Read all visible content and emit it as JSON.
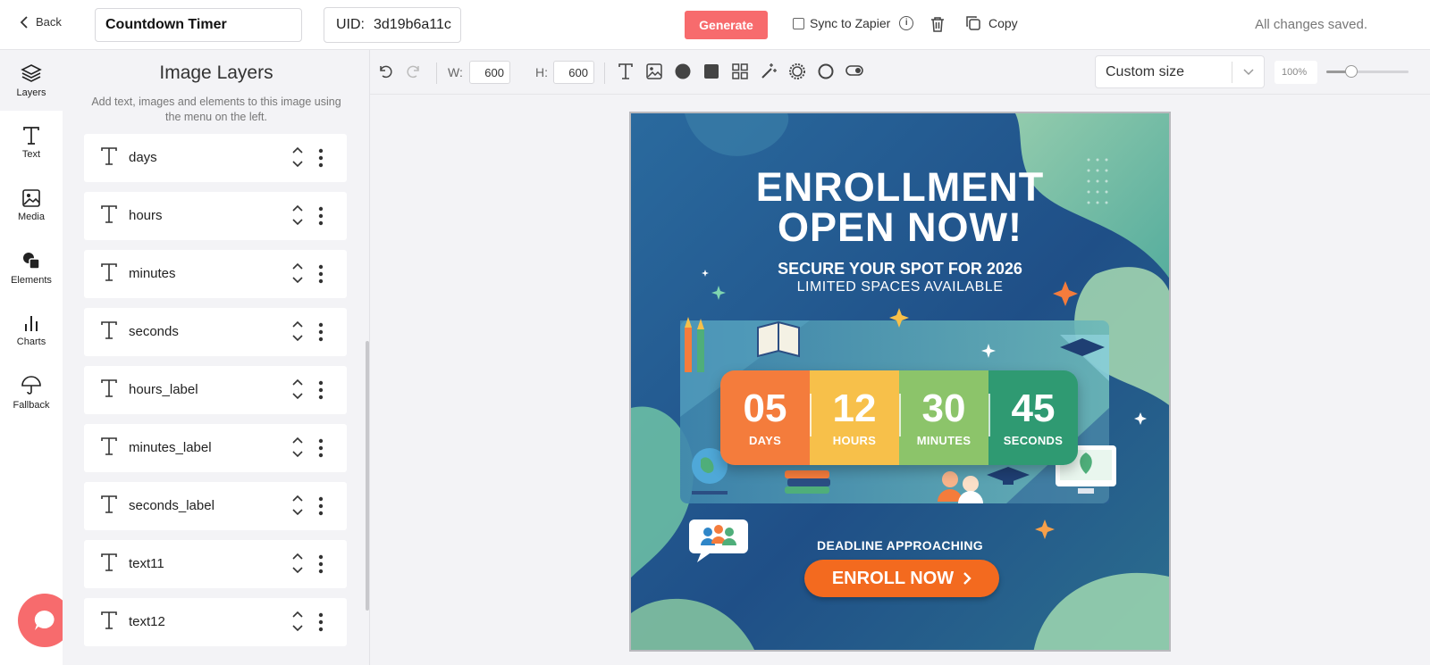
{
  "topbar": {
    "back_label": "Back",
    "title_value": "Countdown Timer",
    "uid_label": "UID:",
    "uid_value": "3d19b6a11c",
    "generate_label": "Generate",
    "sync_label": "Sync to Zapier",
    "copy_label": "Copy",
    "saved_status": "All changes saved."
  },
  "rail": [
    {
      "label": "Layers",
      "icon": "layers-icon",
      "active": true
    },
    {
      "label": "Text",
      "icon": "text-icon"
    },
    {
      "label": "Media",
      "icon": "image-icon"
    },
    {
      "label": "Elements",
      "icon": "shapes-icon"
    },
    {
      "label": "Charts",
      "icon": "bar-chart-icon"
    },
    {
      "label": "Fallback",
      "icon": "umbrella-icon"
    }
  ],
  "panel": {
    "title": "Image Layers",
    "subtitle": "Add text, images and elements to this image using the menu on the left.",
    "layers": [
      "days",
      "hours",
      "minutes",
      "seconds",
      "hours_label",
      "minutes_label",
      "seconds_label",
      "text11",
      "text12"
    ]
  },
  "toolbar": {
    "w_label": "W:",
    "w_value": "600",
    "h_label": "H:",
    "h_value": "600",
    "size_preset": "Custom size",
    "zoom_value": "100%",
    "zoom_fraction": 0.3
  },
  "poster": {
    "headline_1": "ENROLLMENT",
    "headline_2": "OPEN NOW!",
    "sub_1": "SECURE YOUR SPOT FOR 2026",
    "sub_2": "LIMITED SPACES AVAILABLE",
    "countdown": [
      {
        "value": "05",
        "label": "DAYS",
        "color": "#f47c3c"
      },
      {
        "value": "12",
        "label": "HOURS",
        "color": "#f7c04a"
      },
      {
        "value": "30",
        "label": "MINUTES",
        "color": "#8cc46a"
      },
      {
        "value": "45",
        "label": "SECONDS",
        "color": "#2f9a72"
      }
    ],
    "deadline": "DEADLINE APPROACHING",
    "cta": "ENROLL NOW"
  },
  "colors": {
    "accent": "#f76b6d",
    "cta_orange": "#f36a1f",
    "poster_blue": "#245a8f",
    "poster_green": "#8fd0a3"
  }
}
